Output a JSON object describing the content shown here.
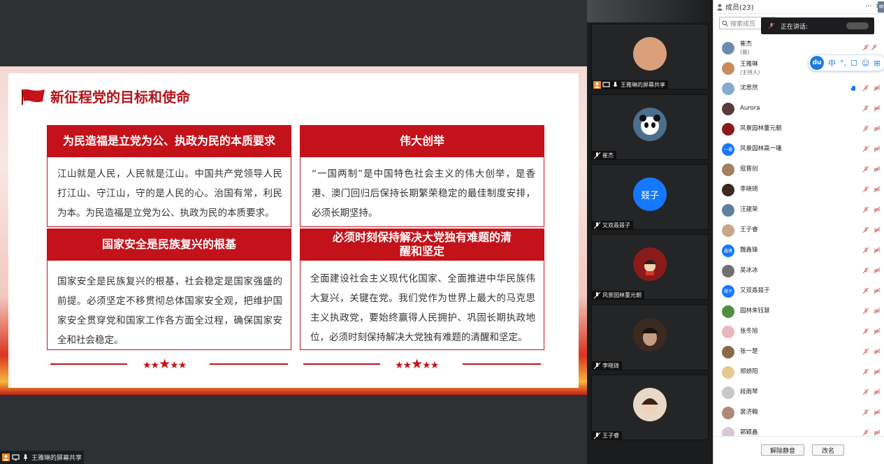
{
  "slide": {
    "title": "新征程党的目标和使命",
    "boxes": [
      {
        "head": "为民造福是立党为公、执政为民的本质要求",
        "body": "江山就是人民，人民就是江山。中国共产党领导人民打江山、守江山，守的是人民的心。治国有常，利民为本。为民造福是立党为公、执政为民的本质要求。"
      },
      {
        "head": "伟大创举",
        "body": "“一国两制”是中国特色社会主义的伟大创举，是香港、澳门回归后保持长期繁荣稳定的最佳制度安排，必须长期坚持。"
      },
      {
        "head": "国家安全是民族复兴的根基",
        "body": "国家安全是民族复兴的根基，社会稳定是国家强盛的前提。必须坚定不移贯彻总体国家安全观，把维护国家安全贯穿党和国家工作各方面全过程，确保国家安全和社会稳定。"
      },
      {
        "head": "必须时刻保持解决大党独有难题的清醒和坚定",
        "body": "全面建设社会主义现代化国家、全面推进中华民族伟大复兴，关键在党。我们党作为世界上最大的马克思主义执政党，要始终赢得人民拥护、巩固长期执政地位，必须时刻保持解决大党独有难题的清醒和坚定。"
      }
    ],
    "stars_small": "★★",
    "star_big": "★",
    "stars_small2": "★★"
  },
  "screen_share_label": "王雅琳的屏幕共享",
  "video_tiles": [
    {
      "name": "王雅琳的屏幕共享",
      "avatar_text": "",
      "color": "#d9a07a"
    },
    {
      "name": "崔杰",
      "avatar_text": "",
      "color": "#4c6f8c"
    },
    {
      "name": "又双叒叕子",
      "avatar_text": "叕子",
      "color": "#1677ff"
    },
    {
      "name": "风景园林董元朝",
      "avatar_text": "",
      "color": "#8b1a1a"
    },
    {
      "name": "李晓琦",
      "avatar_text": "",
      "color": "#3a2a20"
    },
    {
      "name": "王子睿",
      "avatar_text": "",
      "color": "#c9a58a"
    }
  ],
  "panel": {
    "title": "成员(23)",
    "more": "···",
    "close": "✕",
    "menu": "≡",
    "search_placeholder": "搜索成员",
    "speaking_label": "正在讲话:",
    "ime": {
      "logo": "du",
      "lang": "中",
      "items": [
        "°,",
        "☐",
        "☺",
        "⊞"
      ]
    },
    "members": [
      {
        "name": "崔杰",
        "sub": "(我)",
        "color": "#6b8cae",
        "text": ""
      },
      {
        "name": "王雅琳",
        "sub": "(主持人)",
        "color": "#c98b5e",
        "text": ""
      },
      {
        "name": "沈思然",
        "sub": "",
        "color": "#88aacc",
        "text": "",
        "hand": true
      },
      {
        "name": "Aurora",
        "sub": "",
        "color": "#5a3a3a",
        "text": ""
      },
      {
        "name": "风景园林董元朝",
        "sub": "",
        "color": "#8b1a1a",
        "text": ""
      },
      {
        "name": "风景园林高一璠",
        "sub": "",
        "color": "#1677ff",
        "text": "一璠"
      },
      {
        "name": "寇晋创",
        "sub": "",
        "color": "#a08060",
        "text": ""
      },
      {
        "name": "李晓琦",
        "sub": "",
        "color": "#3a2a20",
        "text": ""
      },
      {
        "name": "汪建荣",
        "sub": "",
        "color": "#5f7f9f",
        "text": ""
      },
      {
        "name": "王子睿",
        "sub": "",
        "color": "#c9a58a",
        "text": ""
      },
      {
        "name": "魏鑫锋",
        "sub": "",
        "color": "#1677ff",
        "text": "鑫锋"
      },
      {
        "name": "吴冰冰",
        "sub": "",
        "color": "#707070",
        "text": ""
      },
      {
        "name": "又双叒叕子",
        "sub": "",
        "color": "#1677ff",
        "text": "叕子"
      },
      {
        "name": "园林朱钰慧",
        "sub": "",
        "color": "#4f8f3f",
        "text": ""
      },
      {
        "name": "张冬旭",
        "sub": "",
        "color": "#e8b7c0",
        "text": ""
      },
      {
        "name": "张一楚",
        "sub": "",
        "color": "#8a6a4a",
        "text": ""
      },
      {
        "name": "郑娇阳",
        "sub": "",
        "color": "#e6c890",
        "text": ""
      },
      {
        "name": "段雨琴",
        "sub": "",
        "color": "#c8c8c8",
        "text": ""
      },
      {
        "name": "裴济翰",
        "sub": "",
        "color": "#b08878",
        "text": ""
      },
      {
        "name": "郭颖鑫",
        "sub": "",
        "color": "#d8c8d8",
        "text": ""
      }
    ],
    "unmute_label": "解除静音",
    "rename_label": "改名"
  }
}
